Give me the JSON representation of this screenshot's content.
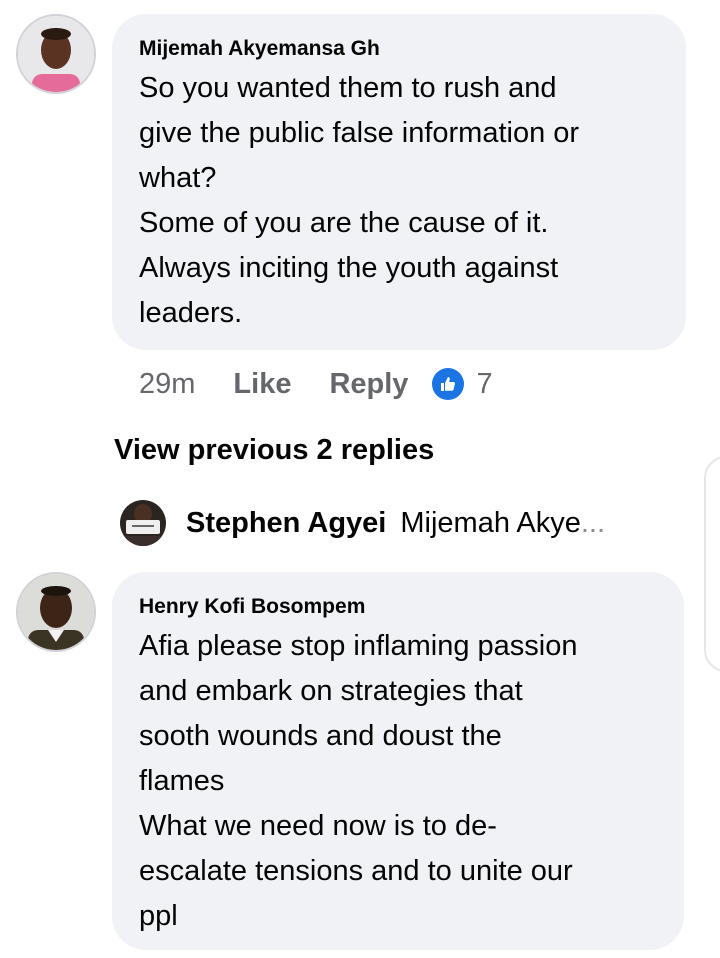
{
  "comments": [
    {
      "author": "Mijemah Akyemansa Gh",
      "lines": "So you wanted them to rush and\ngive the public false information or\nwhat?\nSome of you are the cause of it.\nAlways inciting the youth against\nleaders.",
      "avatar_icon": "profile-photo-man-pink-shirt",
      "time": "29m",
      "like_label": "Like",
      "reply_label": "Reply",
      "reaction_icon": "thumbs-up-icon",
      "reaction_count": "7"
    },
    {
      "author": "Henry Kofi Bosompem",
      "lines": "Afia please stop inflaming passion\nand embark on strategies that\nsooth wounds and doust the\nflames\nWhat we need now is to  de-\nescalate tensions and to unite our\nppl",
      "avatar_icon": "profile-photo-man-dark-jacket"
    }
  ],
  "view_previous_replies": "View previous 2 replies",
  "reply_preview": {
    "author": "Stephen Agyei",
    "text": "Mijemah Akye",
    "ellipsis": "...",
    "avatar_icon": "profile-photo-holding-sign"
  },
  "colors": {
    "bubble": "#f0f2f5",
    "secondary_text": "#65676b",
    "like_blue": "#1b74e4"
  }
}
